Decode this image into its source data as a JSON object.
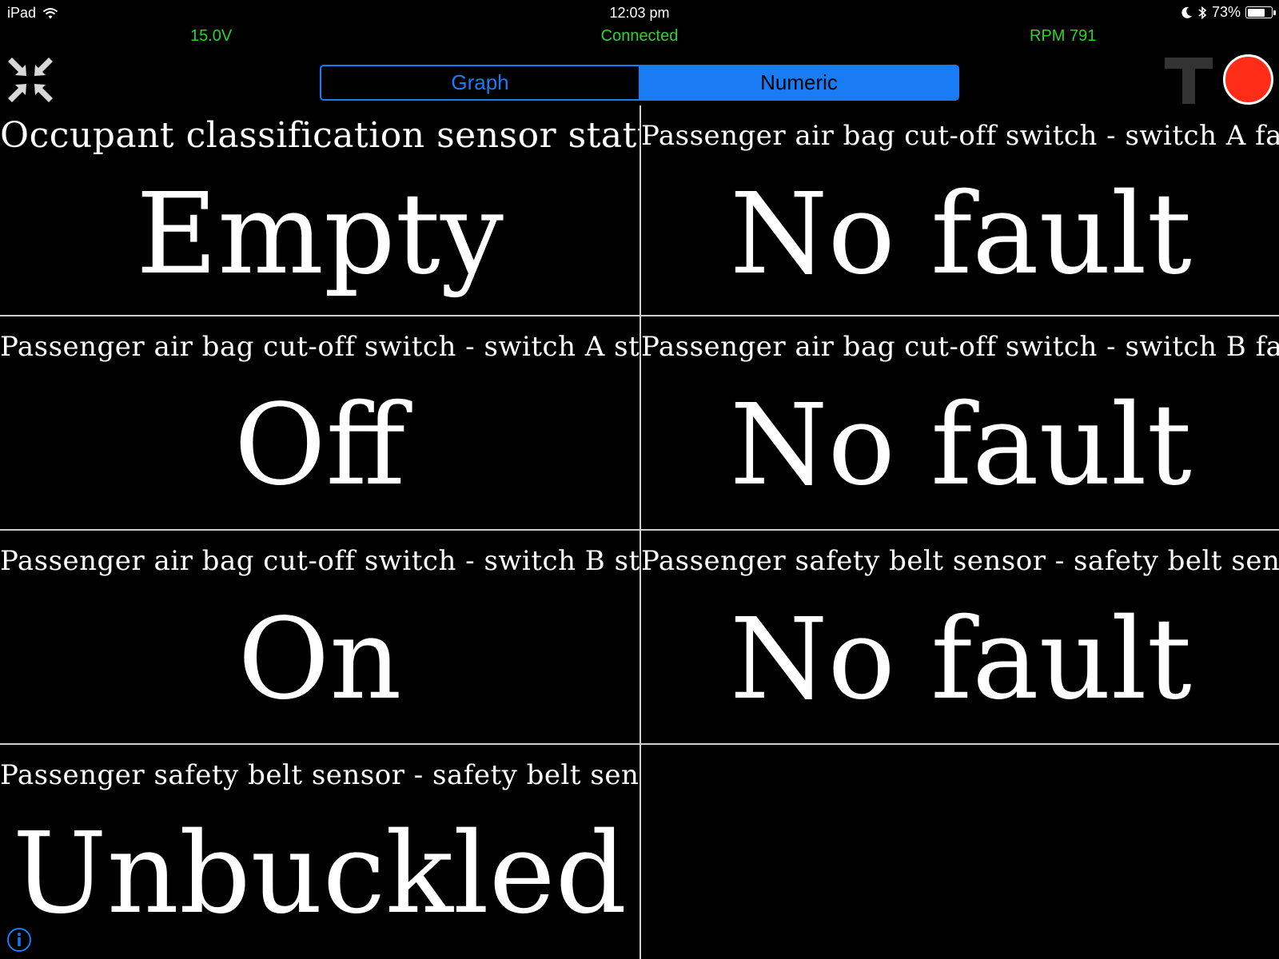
{
  "status_bar": {
    "device": "iPad",
    "time": "12:03 pm",
    "battery": "73%",
    "battery_level": 0.73
  },
  "info": {
    "voltage": "15.0V",
    "connection": "Connected",
    "rpm": "RPM 791"
  },
  "colors": {
    "accent_blue": "#1a7cf5",
    "status_green": "#27d52b",
    "record_red": "#ff2d17"
  },
  "tabs": {
    "graph": "Graph",
    "numeric": "Numeric",
    "selected": "Numeric"
  },
  "icons": {
    "collapse": "collapse-arrows-icon",
    "text_toggle": "text-t-icon",
    "record": "record-icon",
    "info": "info-icon",
    "wifi": "wifi-icon",
    "moon": "moon-icon",
    "bluetooth": "bluetooth-icon",
    "battery": "battery-icon"
  },
  "cells": [
    {
      "label": "Occupant classification sensor status",
      "value": "Empty"
    },
    {
      "label": "Passenger air bag cut-off switch - switch A fault",
      "value": "No fault"
    },
    {
      "label": "Passenger air bag cut-off switch - switch A state",
      "value": "Off"
    },
    {
      "label": "Passenger air bag cut-off switch - switch B fault",
      "value": "No fault"
    },
    {
      "label": "Passenger air bag cut-off switch - switch B state",
      "value": "On"
    },
    {
      "label": "Passenger safety belt sensor - safety belt sensor fault",
      "value": "No fault"
    },
    {
      "label": "Passenger safety belt sensor - safety belt sensor state",
      "value": "Unbuckled"
    }
  ]
}
